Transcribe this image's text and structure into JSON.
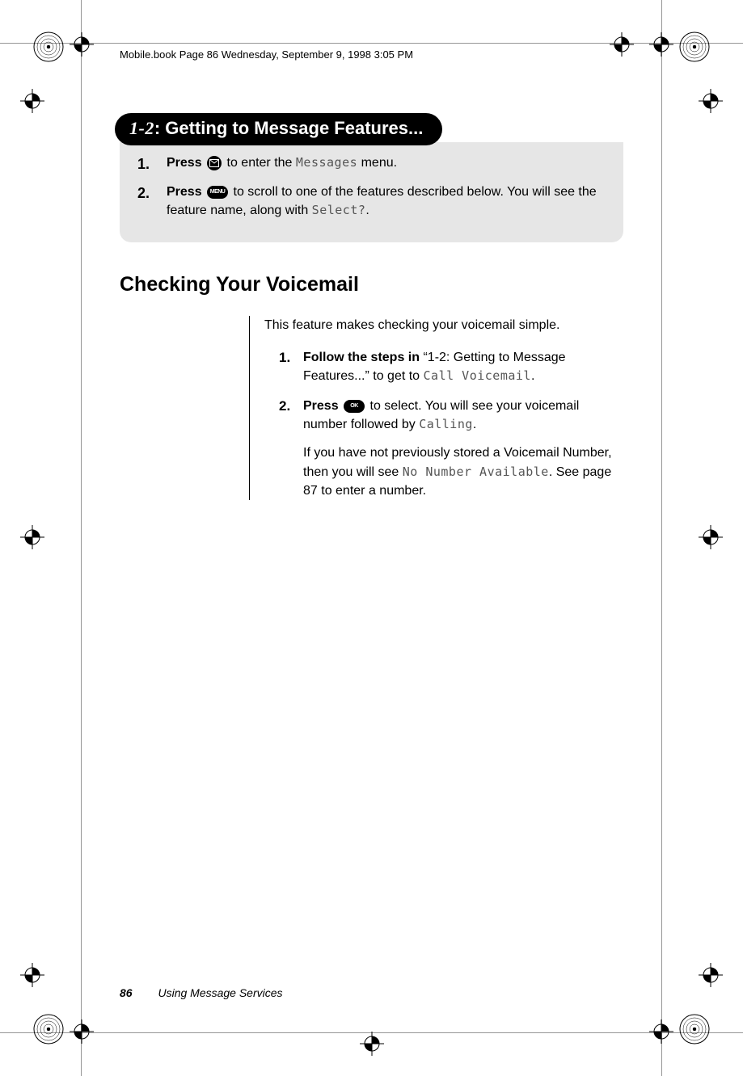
{
  "runhead": "Mobile.book  Page 86  Wednesday, September 9, 1998  3:05 PM",
  "pill": {
    "stepnum": "1-2",
    "title": ": Getting to Message Features..."
  },
  "greySteps": {
    "s1_press": "Press",
    "s1_rest_a": " to enter the ",
    "s1_lcd": "Messages",
    "s1_rest_b": " menu.",
    "s2_press": "Press",
    "s2_key": "MENU",
    "s2_rest_a": " to scroll to one of the features described below. You will see the feature name, along with ",
    "s2_lcd": "Select?",
    "s2_rest_b": "."
  },
  "sectionHeading": "Checking Your Voicemail",
  "intro": "This feature makes checking your voicemail simple.",
  "steps2": {
    "s1_bold": "Follow the steps in",
    "s1_quote": " “1-2: Getting to Message Features...” to get to ",
    "s1_lcd": "Call Voicemail",
    "s1_tail": ".",
    "s2_bold": "Press",
    "s2_key": "OK",
    "s2_a": " to select. You will see your voicemail number followed by ",
    "s2_lcd1": "Calling",
    "s2_mid": ".",
    "s2_extra_a": "If you have not previously stored a Voicemail Number, then you will see ",
    "s2_lcd2": "No Number Available",
    "s2_extra_b": ". See page 87 to enter a number."
  },
  "footer": {
    "pagenum": "86",
    "section": "Using Message Services"
  }
}
